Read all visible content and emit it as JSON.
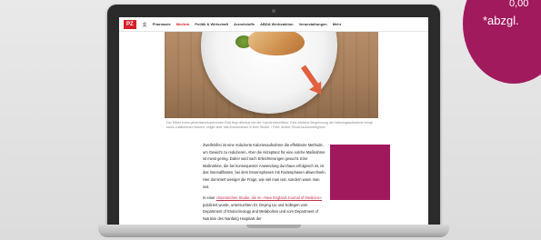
{
  "site": {
    "logo": "PZ",
    "nav_items": [
      "Pharmazie",
      "Medizin",
      "Politik & Wirtschaft",
      "Arzneistoffe",
      "ABDA Werbeaktion",
      "Veranstaltungen",
      "Mehr"
    ],
    "active_nav_index": 1
  },
  "hero": {
    "caption": "Der Effekt eines gewichtsreduzierenden Diät liegt offenbar bei der Kalorienrestriktion. Eine zeitliche Begrenzung der Nahrungsaufnahme bringt kaum zusätzlichen Nutzen, zeigte aber das Autorenteam in ihrer Studie. / Foto: Adobe Stock/Jacktumbleg/foto"
  },
  "article": {
    "paragraph1": "Zweifelsfrei ist eine reduzierte Kalorienaufnahme die effektivste Methode, um Gewicht zu reduzieren. Aber die Akzeptanz für eine solche Maßnahme ist meist gering. Daher wird nach Erleichterungen gesucht. Eine Maßnahme, die bei konsequenter Anwendung durchaus erfolgreich ist, ist das Intervallfasten, bei dem Essensphasen mit Fastenphasen abwechseln. Hier dominiert weniger die Frage, wie viel man isst, sondern wann man isst.",
    "paragraph2_prefix": "In einer ",
    "paragraph2_link": "chinesischen Studie, die im »New England Journal of Medicine«",
    "paragraph2_suffix": " publiziert wurde, untersuchten Dr. Deying Liu und Kollegen vom Department of Endocrinology and Metabolism und vom Department of Nutrition des Nanfang Hospitals der"
  },
  "badge": {
    "text_top": "0,00",
    "text": "*abzgl."
  },
  "colors": {
    "brand_red": "#d62027",
    "badge_magenta": "#a11a5e",
    "ad_magenta": "#a0195d"
  }
}
